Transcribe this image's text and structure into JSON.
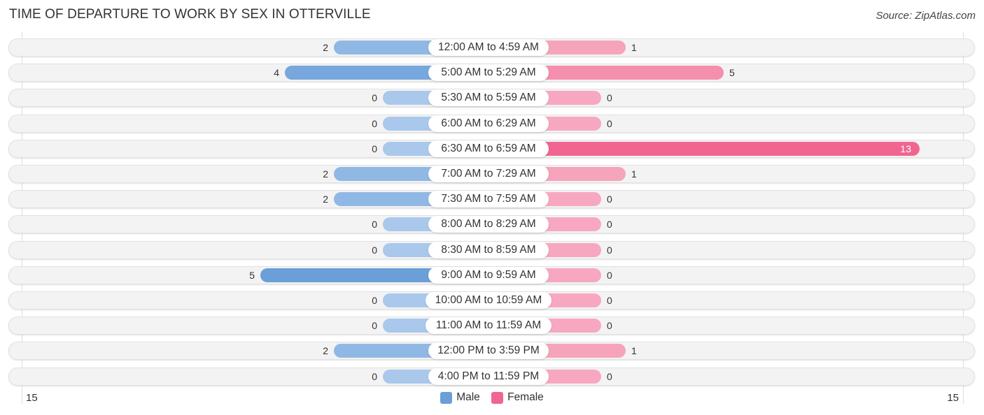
{
  "header": {
    "title": "TIME OF DEPARTURE TO WORK BY SEX IN OTTERVILLE",
    "source": "Source: ZipAtlas.com"
  },
  "colors": {
    "male_strong": "#6a9fd8",
    "male_light": "#a9c8ec",
    "female_strong": "#f06690",
    "female_light": "#f7a8c0"
  },
  "chart_data": {
    "type": "bar",
    "orientation": "horizontal-diverging",
    "title": "TIME OF DEPARTURE TO WORK BY SEX IN OTTERVILLE",
    "categories": [
      "12:00 AM to 4:59 AM",
      "5:00 AM to 5:29 AM",
      "5:30 AM to 5:59 AM",
      "6:00 AM to 6:29 AM",
      "6:30 AM to 6:59 AM",
      "7:00 AM to 7:29 AM",
      "7:30 AM to 7:59 AM",
      "8:00 AM to 8:29 AM",
      "8:30 AM to 8:59 AM",
      "9:00 AM to 9:59 AM",
      "10:00 AM to 10:59 AM",
      "11:00 AM to 11:59 AM",
      "12:00 PM to 3:59 PM",
      "4:00 PM to 11:59 PM"
    ],
    "series": [
      {
        "name": "Male",
        "values": [
          2,
          4,
          0,
          0,
          0,
          2,
          2,
          0,
          0,
          5,
          0,
          0,
          2,
          0
        ]
      },
      {
        "name": "Female",
        "values": [
          1,
          5,
          0,
          0,
          13,
          1,
          0,
          0,
          0,
          0,
          0,
          0,
          1,
          0
        ]
      }
    ],
    "axis": {
      "left_tick": "15",
      "right_tick": "15",
      "range": [
        -15,
        15
      ]
    },
    "legend": {
      "position": "bottom-center",
      "entries": [
        "Male",
        "Female"
      ]
    },
    "xlabel": "",
    "ylabel": ""
  }
}
